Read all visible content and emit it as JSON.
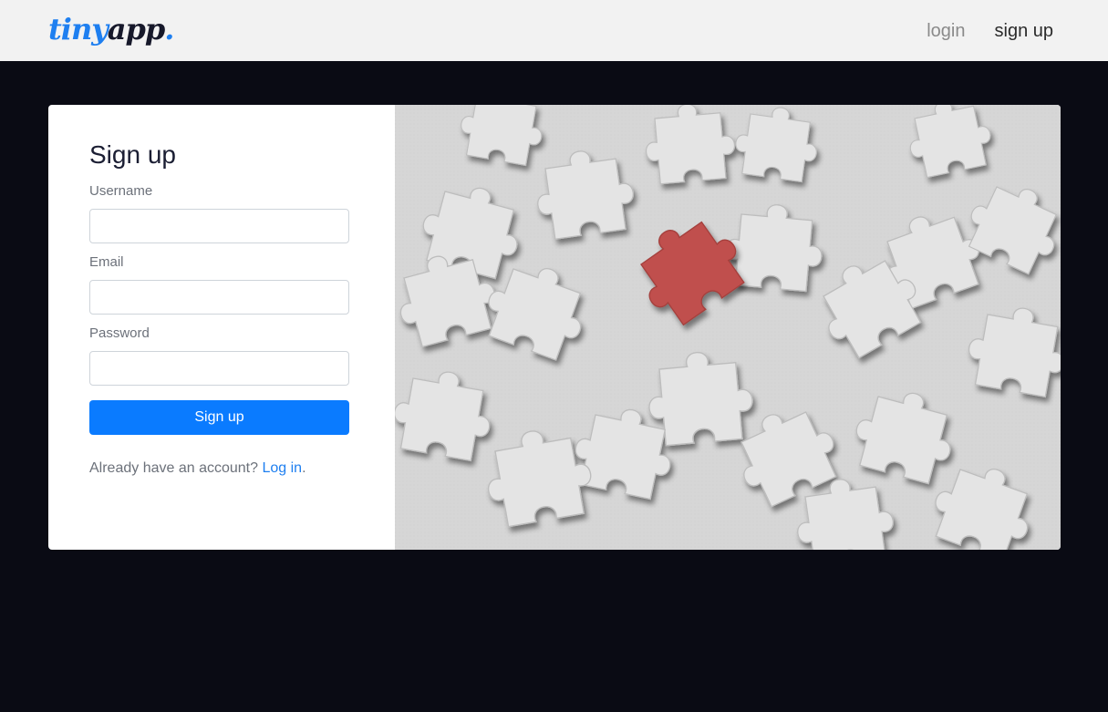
{
  "navbar": {
    "brand_tiny": "tiny",
    "brand_app": "app",
    "brand_dot": ".",
    "login_label": "login",
    "signup_label": "sign up"
  },
  "form": {
    "title": "Sign up",
    "username_label": "Username",
    "email_label": "Email",
    "password_label": "Password",
    "submit_label": "Sign up",
    "hint_text": "Already have an account? ",
    "hint_link": "Log in",
    "hint_end": "."
  },
  "colors": {
    "accent": "#0a7bff",
    "background": "#0a0b14",
    "navbar": "#f2f2f2",
    "highlight_piece": "#c0504d"
  }
}
